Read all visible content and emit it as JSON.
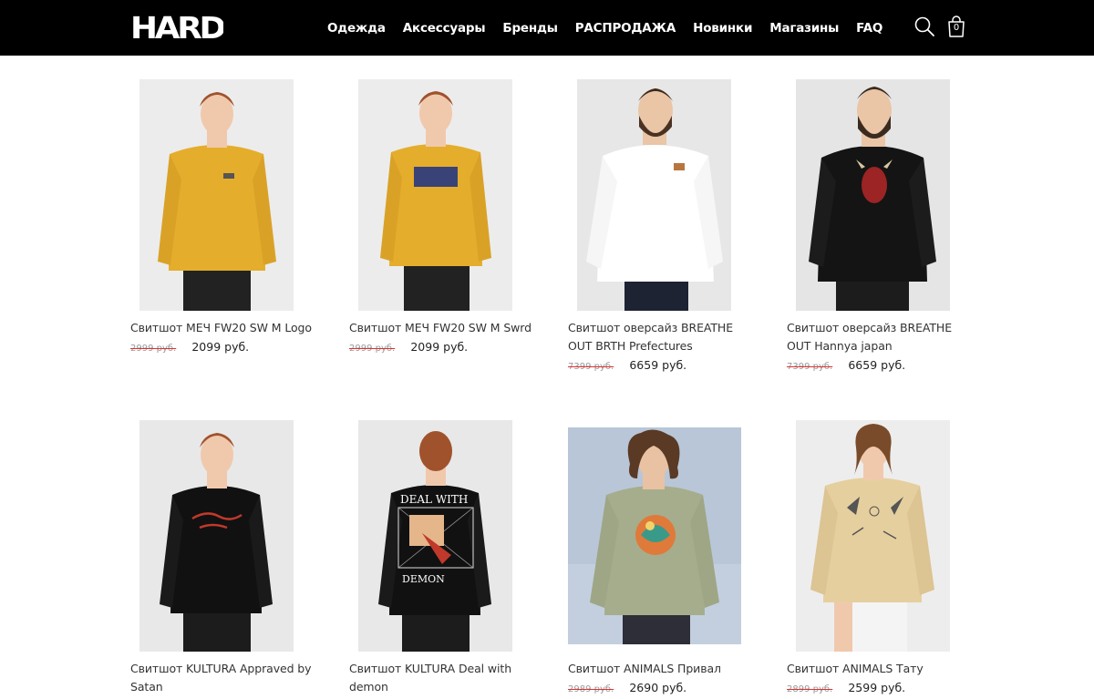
{
  "header": {
    "logo_text": "HARD",
    "nav": [
      "Одежда",
      "Аксессуары",
      "Бренды",
      "РАСПРОДАЖА",
      "Новинки",
      "Магазины",
      "FAQ"
    ],
    "search_icon": "search-icon",
    "cart_icon": "shopping-bag-icon",
    "cart_count": "0"
  },
  "colors": {
    "header_bg": "#000000",
    "sale_strike": "#d33333"
  },
  "products": [
    {
      "title": "Свитшот МЕЧ FW20 SW M Logo",
      "old_price": "2999 руб.",
      "price": "2099 руб.",
      "garment_color": "#e5ad2c",
      "print": "small-logo"
    },
    {
      "title": "Свитшот МЕЧ FW20 SW M Swrd",
      "old_price": "2999 руб.",
      "price": "2099 руб.",
      "garment_color": "#e5ad2c",
      "print": "mech-logo"
    },
    {
      "title": "Свитшот оверсайз BREATHE OUT BRTH Prefectures",
      "old_price": "7399 руб.",
      "price": "6659 руб.",
      "garment_color": "#ffffff",
      "print": "small-patch"
    },
    {
      "title": "Свитшот оверсайз BREATHE OUT Hannya japan",
      "old_price": "7399 руб.",
      "price": "6659 руб.",
      "garment_color": "#141414",
      "print": "hannya-mask"
    },
    {
      "title": "Свитшот KULTURA Appraved by Satan",
      "old_price": "",
      "price": "",
      "garment_color": "#111111",
      "print": "script-text"
    },
    {
      "title": "Свитшот KULTURA Deal with demon",
      "old_price": "",
      "price": "",
      "garment_color": "#111111",
      "print": "deal-with-demon-back"
    },
    {
      "title": "Свитшот ANIMALS Привал",
      "old_price": "2989 руб.",
      "price": "2690 руб.",
      "garment_color": "#a6ad8c",
      "print": "animals-picture"
    },
    {
      "title": "Свитшот ANIMALS Тату",
      "old_price": "2899 руб.",
      "price": "2599 руб.",
      "garment_color": "#e6cf9e",
      "print": "tattoo-flash"
    }
  ]
}
